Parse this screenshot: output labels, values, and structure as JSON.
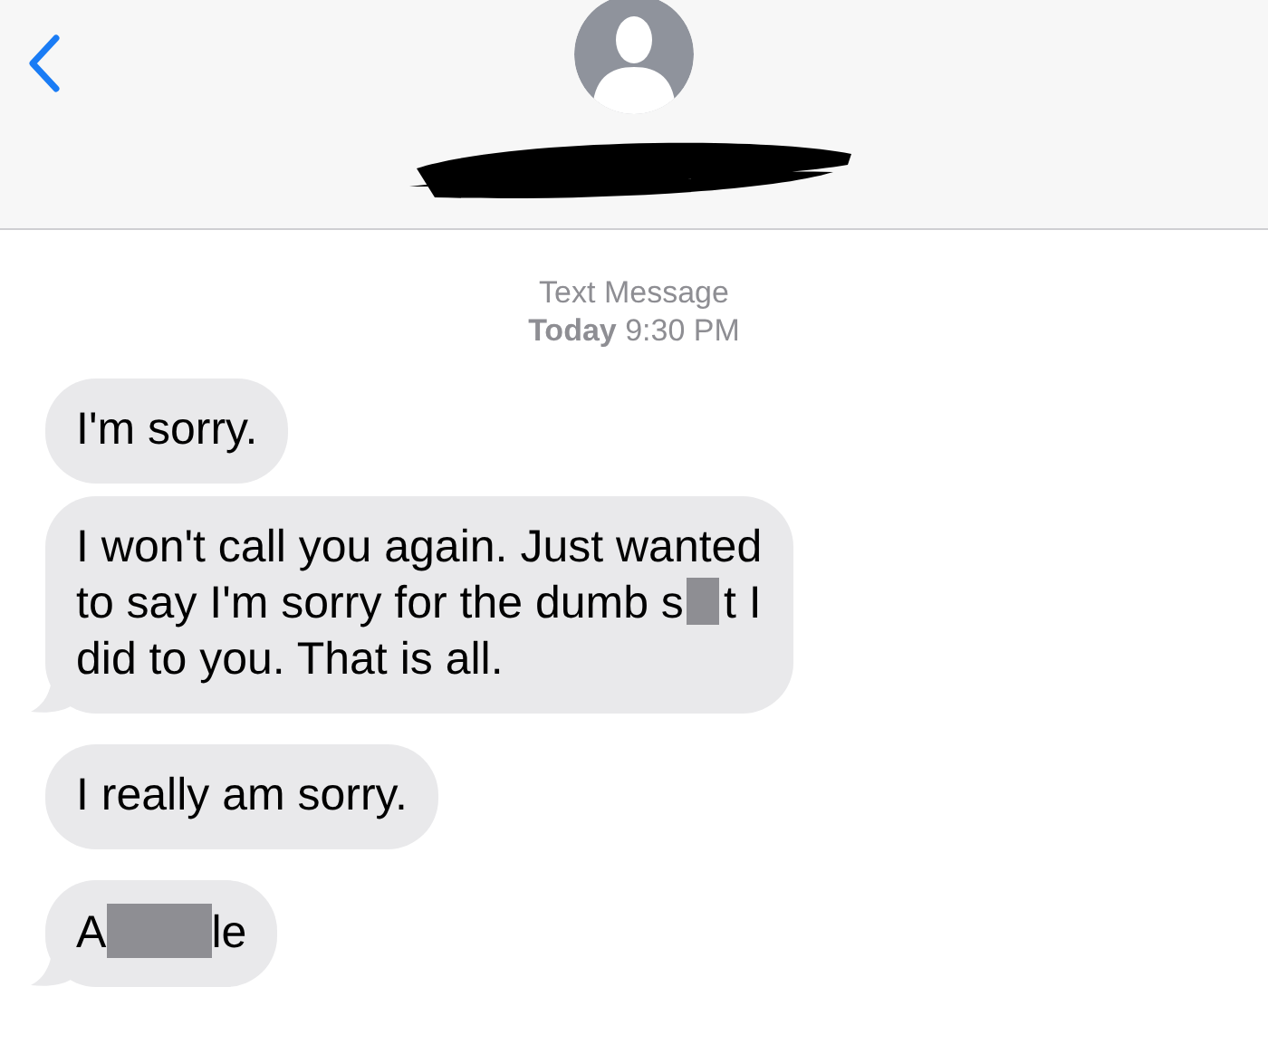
{
  "timestamp": {
    "service": "Text Message",
    "time": "**Today** 9:30 PM"
  },
  "messages": [
    {
      "tail": false,
      "lines": [
        [
          {
            "kind": "text",
            "text": "I'm sorry."
          }
        ]
      ]
    },
    {
      "tail": true,
      "lines": [
        [
          {
            "kind": "text",
            "text": "I won't call you again. Just wanted"
          }
        ],
        [
          {
            "kind": "text",
            "text": "to say I'm sorry for the dumb s"
          },
          {
            "kind": "redaction"
          },
          {
            "kind": "text",
            "text": "t I"
          }
        ],
        [
          {
            "kind": "text",
            "text": "did to you. That is all."
          }
        ]
      ]
    },
    {
      "tail": false,
      "lines": [
        [
          {
            "kind": "text",
            "text": "I really am sorry."
          }
        ]
      ]
    },
    {
      "tail": true,
      "lines": [
        [
          {
            "kind": "text",
            "text": "A"
          },
          {
            "kind": "redaction"
          },
          {
            "kind": "text",
            "text": "le"
          }
        ]
      ]
    }
  ]
}
